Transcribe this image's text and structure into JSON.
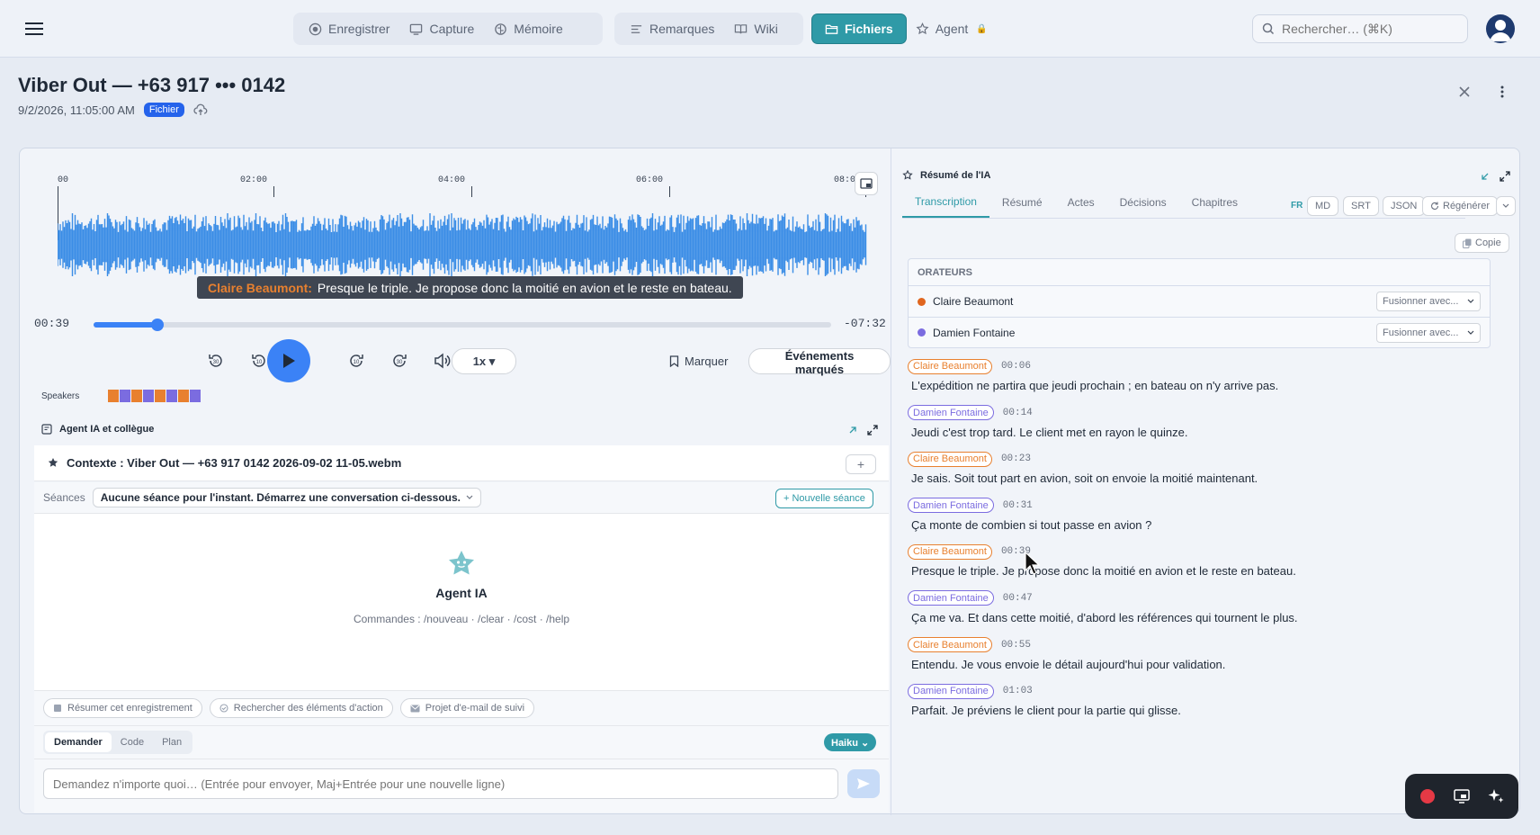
{
  "topbar": {
    "nav": [
      {
        "label": "Enregistrer",
        "icon": "record-icon"
      },
      {
        "label": "Capture",
        "icon": "monitor-icon"
      },
      {
        "label": "Mémoire",
        "icon": "brain-icon"
      },
      {
        "label": "Remarques",
        "icon": "notes-icon"
      },
      {
        "label": "Wiki",
        "icon": "book-icon"
      },
      {
        "label": "Fichiers",
        "icon": "folder-icon",
        "active": true
      },
      {
        "label": "Agent",
        "icon": "robot-icon",
        "locked": true
      }
    ],
    "search_placeholder": "Rechercher… (⌘K)"
  },
  "header": {
    "title": "Viber Out — +63 917 ••• 0142",
    "datetime": "9/2/2026, 11:05:00 AM",
    "badge": "Fichier"
  },
  "player": {
    "time_ticks": [
      "00",
      "02:00",
      "04:00",
      "06:00",
      "08:0"
    ],
    "caption_speaker": "Claire Beaumont:",
    "caption_text": "Presque le triple. Je propose donc la moitié en avion et le reste en bateau.",
    "current_time": "00:39",
    "remaining_time": "-07:32",
    "progress_fraction": 0.086,
    "speed": "1x ▾",
    "mark_label": "Marquer",
    "events_label": "Événements marqués",
    "speakers_label": "Speakers",
    "speaker_strip": [
      "#e8802f",
      "#7b6ce0",
      "#e8802f",
      "#7b6ce0",
      "#e8802f",
      "#7b6ce0",
      "#e8802f",
      "#7b6ce0"
    ],
    "wave_color": "#3b8de6"
  },
  "agent": {
    "section_title": "Agent IA et collègue",
    "context": "Contexte : Viber Out — +63 917 0142 2026-09-02 11-05.webm",
    "sessions_label": "Séances",
    "sessions_value": "Aucune séance pour l'instant. Démarrez une conversation ci-dessous.",
    "new_session": "+ Nouvelle séance",
    "name": "Agent IA",
    "commands": "Commandes : /nouveau · /clear · /cost · /help",
    "suggestions": [
      "Résumer cet enregistrement",
      "Rechercher des éléments d'action",
      "Projet d'e-mail de suivi"
    ],
    "modes": [
      "Demander",
      "Code",
      "Plan"
    ],
    "model": "Haiku",
    "input_placeholder": "Demandez n'importe quoi… (Entrée pour envoyer, Maj+Entrée pour une nouvelle ligne)"
  },
  "summary": {
    "title": "Résumé de l'IA",
    "tabs": [
      "Transcription",
      "Résumé",
      "Actes",
      "Décisions",
      "Chapitres"
    ],
    "lang": "FR",
    "formats": [
      "MD",
      "SRT",
      "JSON"
    ],
    "regenerate": "Régénérer",
    "copy": "Copie",
    "speakers_title": "ORATEURS",
    "speakers": [
      {
        "name": "Claire Beaumont",
        "color": "#e0661f",
        "merge": "Fusionner avec..."
      },
      {
        "name": "Damien Fontaine",
        "color": "#7b6ce0",
        "merge": "Fusionner avec..."
      }
    ],
    "segments": [
      {
        "speaker": "Claire Beaumont",
        "who": "claire",
        "time": "00:06",
        "text": "L'expédition ne partira que jeudi prochain ; en bateau on n'y arrive pas."
      },
      {
        "speaker": "Damien Fontaine",
        "who": "damien",
        "time": "00:14",
        "text": "Jeudi c'est trop tard. Le client met en rayon le quinze."
      },
      {
        "speaker": "Claire Beaumont",
        "who": "claire",
        "time": "00:23",
        "text": "Je sais. Soit tout part en avion, soit on envoie la moitié maintenant."
      },
      {
        "speaker": "Damien Fontaine",
        "who": "damien",
        "time": "00:31",
        "text": "Ça monte de combien si tout passe en avion ?"
      },
      {
        "speaker": "Claire Beaumont",
        "who": "claire",
        "time": "00:39",
        "text": "Presque le triple. Je propose donc la moitié en avion et le reste en bateau."
      },
      {
        "speaker": "Damien Fontaine",
        "who": "damien",
        "time": "00:47",
        "text": "Ça me va. Et dans cette moitié, d'abord les références qui tournent le plus."
      },
      {
        "speaker": "Claire Beaumont",
        "who": "claire",
        "time": "00:55",
        "text": "Entendu. Je vous envoie le détail aujourd'hui pour validation."
      },
      {
        "speaker": "Damien Fontaine",
        "who": "damien",
        "time": "01:03",
        "text": "Parfait. Je préviens le client pour la partie qui glisse."
      }
    ]
  }
}
